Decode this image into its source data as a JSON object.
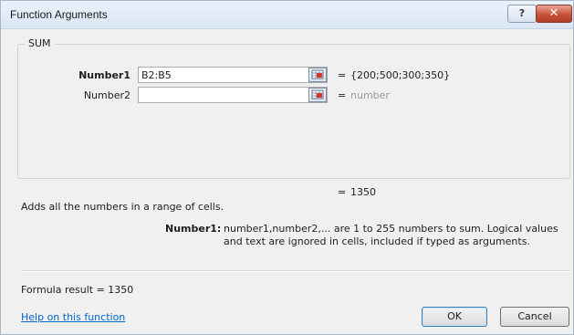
{
  "window": {
    "title": "Function Arguments",
    "help_label": "?",
    "close_label": "✕"
  },
  "function": {
    "name": "SUM",
    "args": [
      {
        "label": "Number1",
        "value": "B2:B5",
        "result": "{200;500;300;350}"
      },
      {
        "label": "Number2",
        "value": "",
        "result": "number"
      }
    ],
    "equals": "=",
    "result": "1350",
    "description": "Adds all the numbers in a range of cells.",
    "arg_desc_label": "Number1:",
    "arg_desc": "number1,number2,... are 1 to 255 numbers to sum. Logical values and text are ignored in cells, included if typed as arguments."
  },
  "footer": {
    "formula_result": "Formula result =  1350",
    "help_link": "Help on this function",
    "ok_label": "OK",
    "cancel_label": "Cancel"
  },
  "icons": {
    "ref_button": "range-select-icon"
  }
}
